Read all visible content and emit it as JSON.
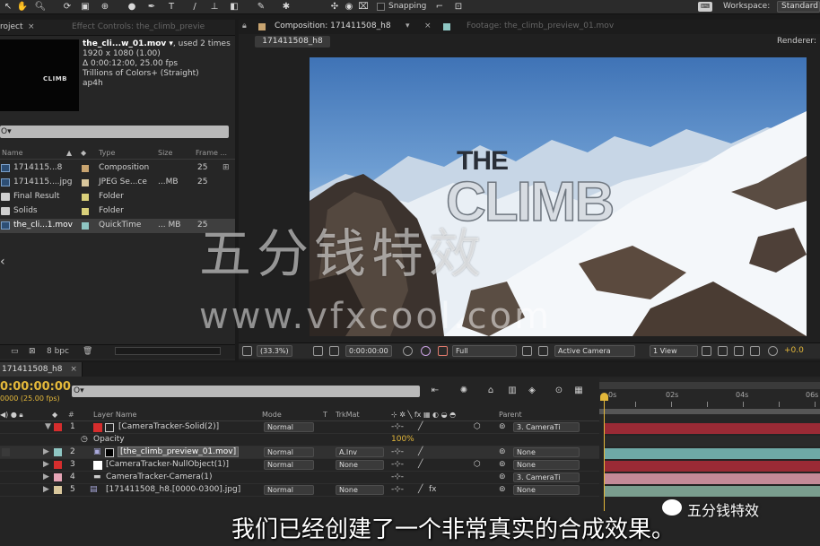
{
  "toolbar": {
    "snapping_label": "Snapping",
    "workspace_label": "Workspace:",
    "workspace_value": "Standard"
  },
  "project_panel": {
    "tab_project": "roject",
    "tab_effect_controls": "Effect Controls: the_climb_previe",
    "thumbnail_text": "CLIMB",
    "info": {
      "name": "the_cli...w_01.mov ▾",
      "used": ", used 2 times",
      "resolution": "1920 x 1080 (1.00)",
      "duration": "Δ 0:00:12:00, 25.00 fps",
      "colors": "Trillions of Colors+ (Straight)",
      "codec": "ap4h"
    },
    "search_value": "O▾",
    "columns": {
      "name": "Name",
      "type": "Type",
      "size": "Size",
      "frame": "Frame ..."
    },
    "items": [
      {
        "name": "1714115...8",
        "type": "Composition",
        "size": "",
        "frame": "25",
        "color": "#c8a470"
      },
      {
        "name": "1714115....jpg",
        "type": "JPEG Se...ce",
        "size": "...MB",
        "frame": "25",
        "color": "#d9c79c"
      },
      {
        "name": "Final Result",
        "type": "Folder",
        "size": "",
        "frame": "",
        "color": "#d9d07a"
      },
      {
        "name": "Solids",
        "type": "Folder",
        "size": "",
        "frame": "",
        "color": "#d9d07a"
      },
      {
        "name": "the_cli...1.mov",
        "type": "QuickTime",
        "size": "... MB",
        "frame": "25",
        "color": "#8fc7c4"
      }
    ],
    "bpc": "8 bpc"
  },
  "composition_panel": {
    "tab_composition": "Composition: 171411508_h8",
    "tab_footage": "Footage: the_climb_preview_01.mov",
    "breadcrumb": "171411508_h8",
    "renderer_label": "Renderer:",
    "title_the": "THE",
    "title_climb": "CLIMB",
    "zoom": "(33.3%)",
    "timecode": "0:00:00:00",
    "resolution": "Full",
    "camera": "Active Camera",
    "views": "1 View",
    "exposure": "+0.0"
  },
  "timeline": {
    "tab_label": "171411508_h8",
    "timecode": "0:00:00:00",
    "fps": "0000 (25.00 fps)",
    "search_value": "O▾",
    "columns": {
      "num": "#",
      "layer_name": "Layer Name",
      "mode": "Mode",
      "t": "T",
      "trkmat": "TrkMat",
      "parent": "Parent"
    },
    "ruler_ticks": [
      "0s",
      "02s",
      "04s",
      "06s"
    ],
    "layers": [
      {
        "num": "1",
        "name": "[CameraTracker-Solid(2)]",
        "mode": "Normal",
        "trkmat": "",
        "parent": "3. CameraTi",
        "color": "#d62d2d",
        "bar": "#9a2a35",
        "expanded": true
      },
      {
        "num": "",
        "name": "Opacity",
        "mode": "",
        "trkmat": "",
        "parent": "",
        "value": "100%",
        "color": "",
        "bar": "",
        "property": true
      },
      {
        "num": "2",
        "name": "[the_climb_preview_01.mov]",
        "mode": "Normal",
        "trkmat": "A.Inv",
        "parent": "None",
        "color": "#8fc7c4",
        "bar": "#6ea9a6",
        "selected": true
      },
      {
        "num": "3",
        "name": "[CameraTracker-NullObject(1)]",
        "mode": "Normal",
        "trkmat": "None",
        "parent": "None",
        "color": "#d62d2d",
        "bar": "#9a2a35"
      },
      {
        "num": "4",
        "name": "CameraTracker-Camera(1)",
        "mode": "",
        "trkmat": "",
        "parent": "3. CameraTi",
        "color": "#e6a5b6",
        "bar": "#c48a98"
      },
      {
        "num": "5",
        "name": "[171411508_h8.[0000-0300].jpg]",
        "mode": "Normal",
        "trkmat": "None",
        "parent": "None",
        "color": "#d9c79c",
        "bar": "#7a9d8e"
      }
    ]
  },
  "overlay": {
    "watermark_cn": "五分钱特效",
    "watermark_url": "www.vfxcool.com",
    "subtitle": "我们已经创建了一个非常真实的合成效果。",
    "wechat_label": "五分钱特效"
  }
}
